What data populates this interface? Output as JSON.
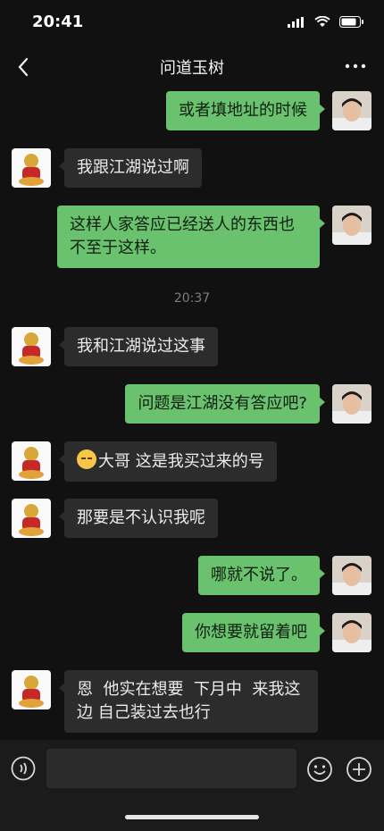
{
  "status_bar": {
    "time": "20:41"
  },
  "header": {
    "title": "问道玉树"
  },
  "messages": [
    {
      "from": "me",
      "text": "或者填地址的时候"
    },
    {
      "from": "them",
      "text": "我跟江湖说过啊"
    },
    {
      "from": "me",
      "text": "这样人家答应已经送人的东西也不至于这样。"
    },
    {
      "from": "system",
      "text": "20:37"
    },
    {
      "from": "them",
      "text": "我和江湖说过这事"
    },
    {
      "from": "me",
      "text": "问题是江湖没有答应吧?"
    },
    {
      "from": "them",
      "text": "大哥 这是我买过来的号",
      "emoji": "sleepy-face-icon"
    },
    {
      "from": "them",
      "text": "那要是不认识我呢"
    },
    {
      "from": "me",
      "text": "哪就不说了。"
    },
    {
      "from": "me",
      "text": "你想要就留着吧"
    },
    {
      "from": "them",
      "text": "恩  他实在想要  下月中  来我这边 自己装过去也行"
    }
  ],
  "input_bar": {
    "placeholder": ""
  },
  "colors": {
    "me_bubble": "#6bc26e",
    "them_bubble": "#2c2c2c",
    "background": "#111111"
  }
}
